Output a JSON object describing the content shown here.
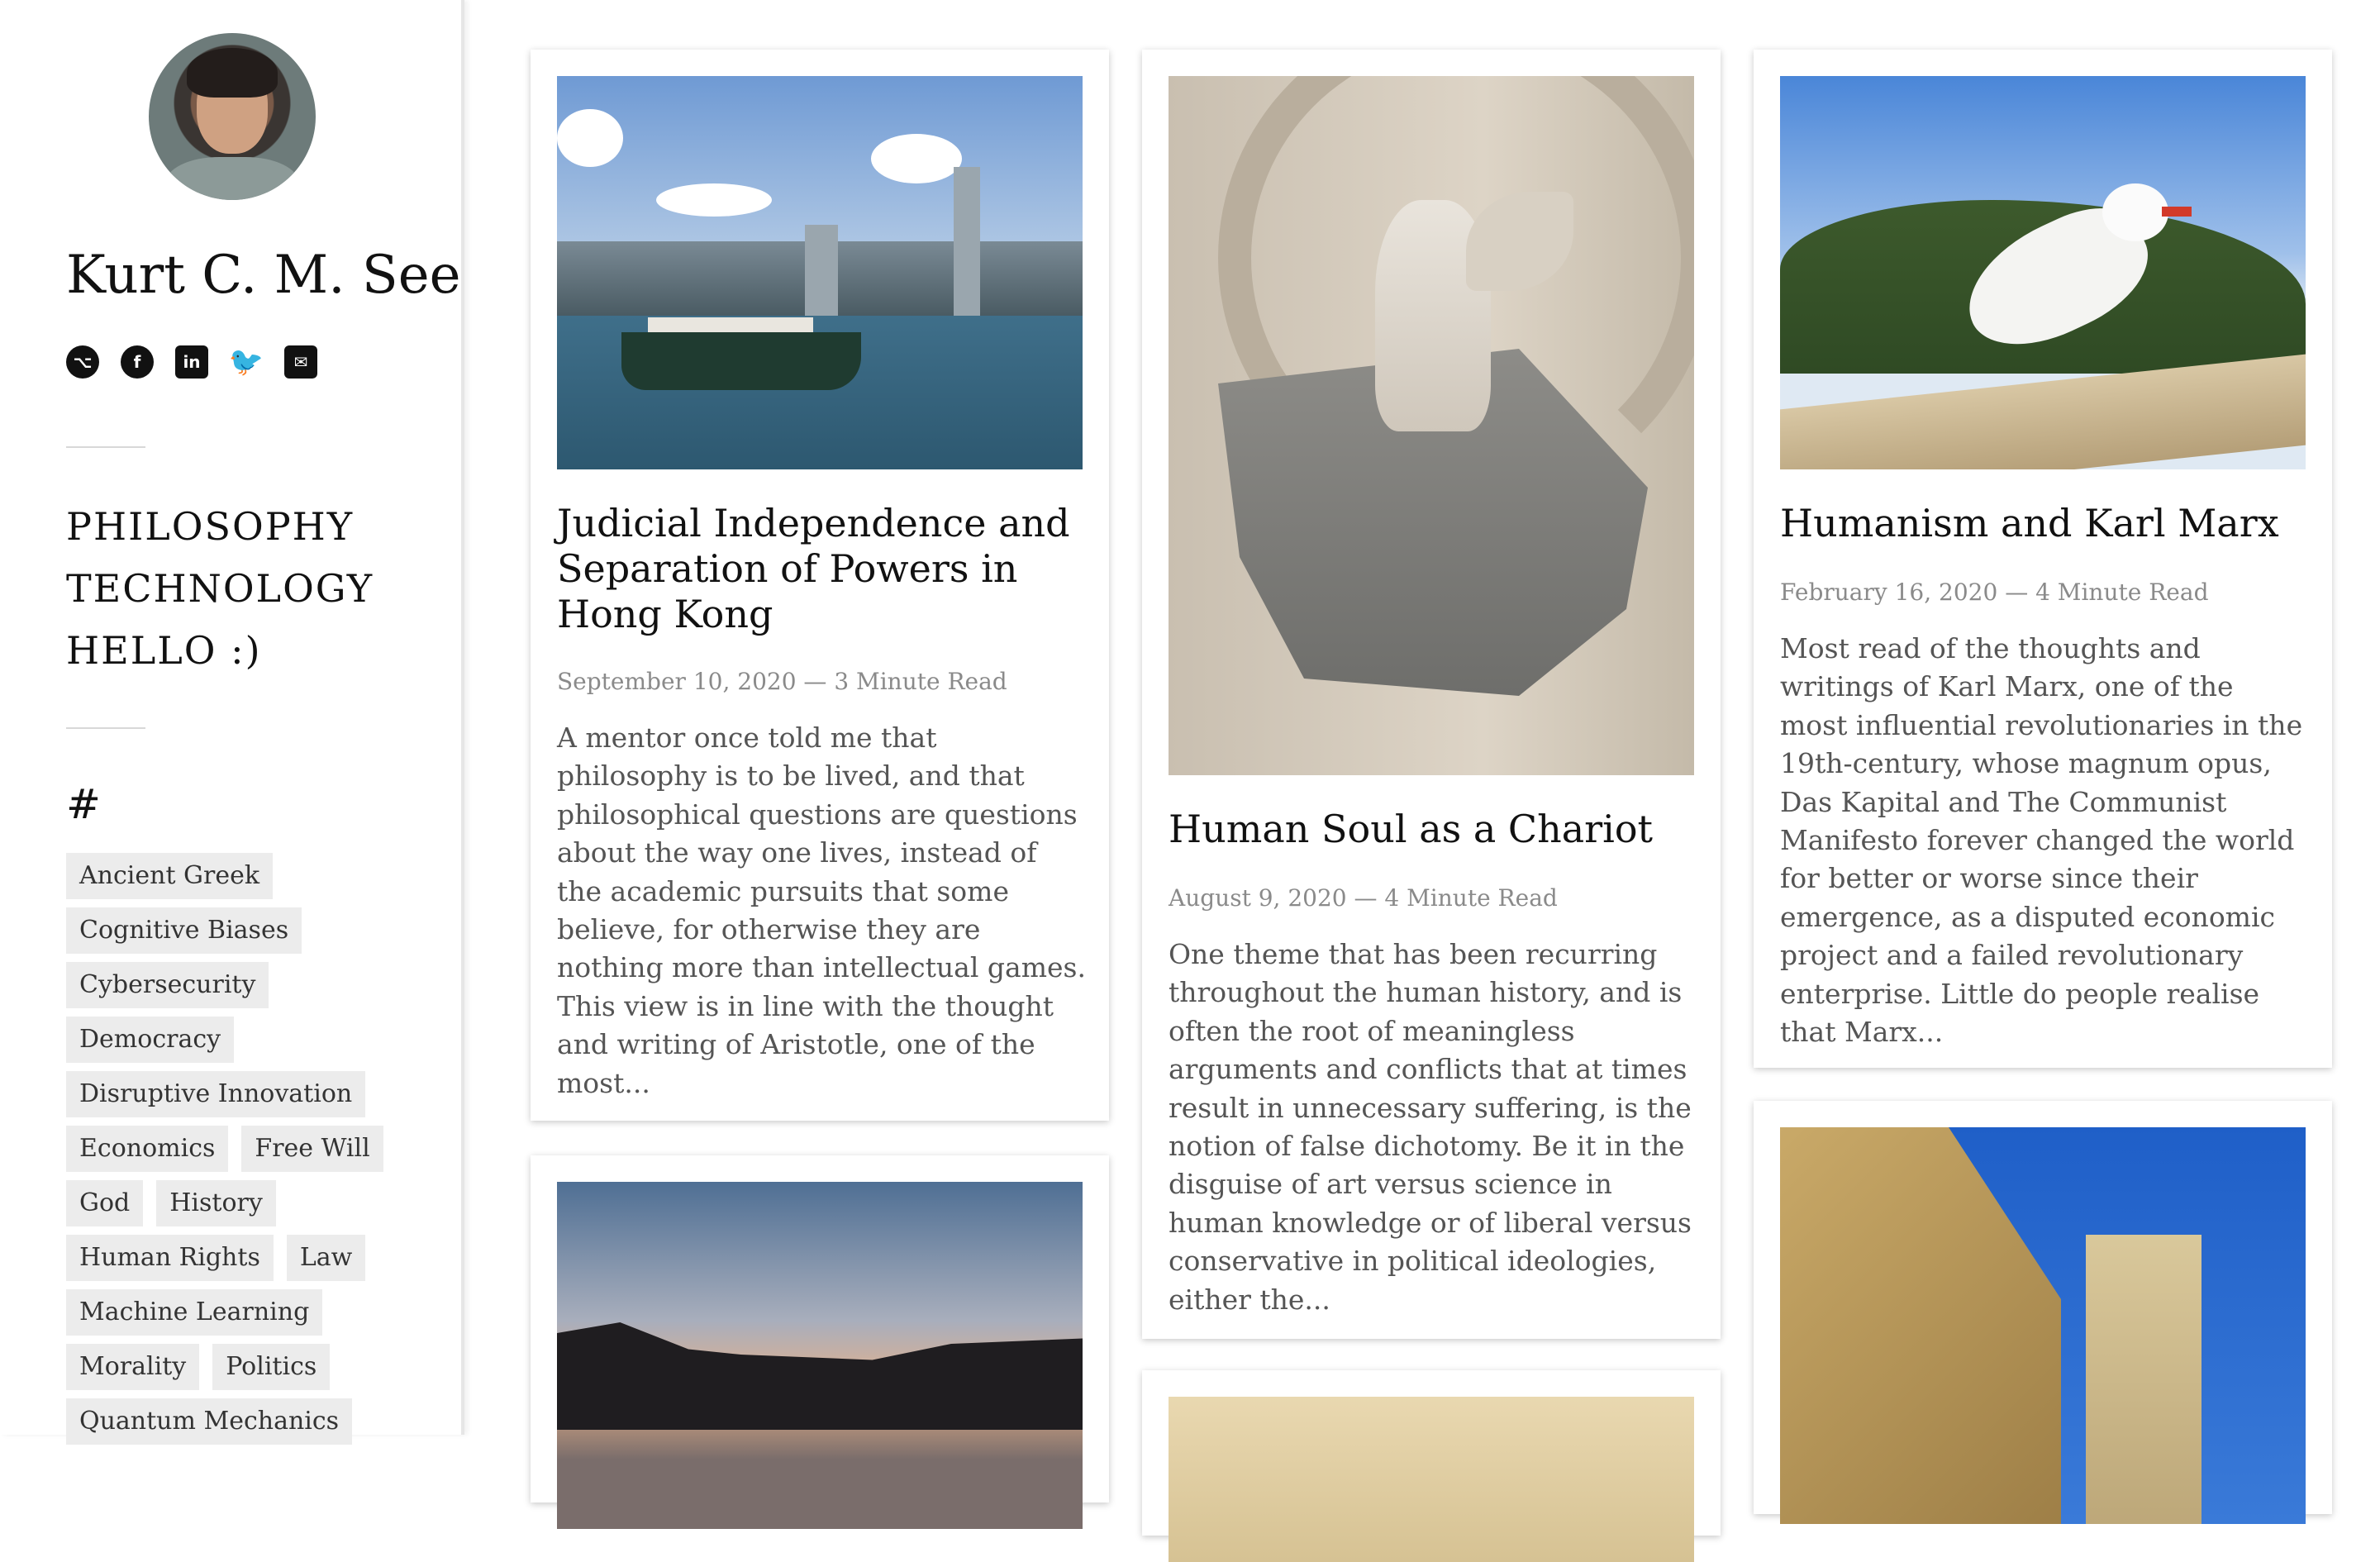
{
  "sidebar": {
    "site_title": "Kurt C. M. See",
    "social_icons": [
      "github-icon",
      "facebook-icon",
      "linkedin-icon",
      "twitter-icon",
      "mail-icon"
    ],
    "nav": [
      "PHILOSOPHY",
      "TECHNOLOGY",
      "HELLO :)"
    ],
    "tags_heading": "#",
    "tags": [
      "Ancient Greek",
      "Cognitive Biases",
      "Cybersecurity",
      "Democracy",
      "Disruptive Innovation",
      "Economics",
      "Free Will",
      "God",
      "History",
      "Human Rights",
      "Law",
      "Machine Learning",
      "Morality",
      "Politics",
      "Quantum Mechanics"
    ]
  },
  "posts": [
    {
      "title": "Judicial Independence and Separation of Powers in Hong Kong",
      "meta": "September 10, 2020 — 3 Minute Read",
      "excerpt": "A mentor once told me that philosophy is to be lived, and that philosophical questions are questions about the way one lives, instead of the academic pursuits that some believe, for otherwise they are nothing more than intellectual games. This view is in line with the thought and writing of Aristotle, one of the most...",
      "image": "hong-kong-harbour-ferry"
    },
    {
      "title": "Human Soul as a Chariot",
      "meta": "August 9, 2020 — 4 Minute Read",
      "excerpt": "One theme that has been recurring throughout the human history, and is often the root of meaningless arguments and conflicts that at times result in unnecessary suffering, is the notion of false dichotomy. Be it in the disguise of art versus science in human knowledge or of liberal versus conservative in political ideologies, either the...",
      "image": "winged-victory-statue"
    },
    {
      "title": "Humanism and Karl Marx",
      "meta": "February 16, 2020 — 4 Minute Read",
      "excerpt": "Most read of the thoughts and writings of Karl Marx, one of the most influential revolutionaries in the 19th-century, whose magnum opus, Das Kapital and The Communist Manifesto forever changed the world for better or worse since their emergence, as a disputed economic project and a failed revolutionary enterprise. Little do people realise that Marx...",
      "image": "seagull-on-railing"
    }
  ],
  "more_posts_images": [
    "florence-sunset",
    "building-facade",
    "bath-abbey"
  ]
}
